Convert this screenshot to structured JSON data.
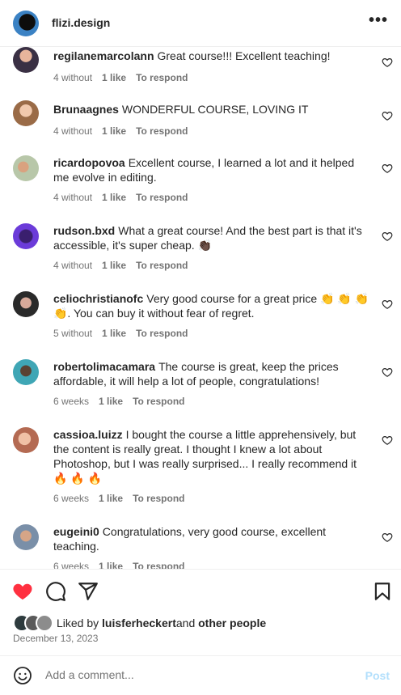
{
  "header": {
    "username": "flizi.design",
    "more_icon": "three-dots-icon"
  },
  "comments": [
    {
      "user": "regilanemarcolann",
      "text": "Great course!!! Excellent teaching!",
      "time": "4 without",
      "likes": "1 like",
      "reply": "To respond"
    },
    {
      "user": "Brunaagnes",
      "text": "WONDERFUL COURSE, LOVING IT",
      "time": "4 without",
      "likes": "1 like",
      "reply": "To respond"
    },
    {
      "user": "ricardopovoa",
      "text": "Excellent course, I learned a lot and it helped me evolve in editing.",
      "time": "4 without",
      "likes": "1 like",
      "reply": "To respond"
    },
    {
      "user": "rudson.bxd",
      "text": "What a great course! And the best part is that it's accessible, it's super cheap. 👏🏿",
      "time": "4 without",
      "likes": "1 like",
      "reply": "To respond"
    },
    {
      "user": "celiochristianofc",
      "text": "Very good course for a great price 👏 👏 👏 👏. You can buy it without fear of regret.",
      "time": "5 without",
      "likes": "1 like",
      "reply": "To respond"
    },
    {
      "user": "robertolimacamara",
      "text": "The course is great, keep the prices affordable, it will help a lot of people, congratulations!",
      "time": "6 weeks",
      "likes": "1 like",
      "reply": "To respond"
    },
    {
      "user": "cassioa.luizz",
      "text": "I bought the course a little apprehensively, but the content is really great. I thought I knew a lot about Photoshop, but I was really surprised... I really recommend it 🔥 🔥 🔥",
      "time": "6 weeks",
      "likes": "1 like",
      "reply": "To respond"
    },
    {
      "user": "eugeini0",
      "text": "Congratulations, very good course, excellent teaching.",
      "time": "6 weeks",
      "likes": "1 like",
      "reply": "To respond"
    }
  ],
  "actions": {
    "like_icon": "heart-filled-icon",
    "comment_icon": "comment-icon",
    "share_icon": "share-icon",
    "save_icon": "bookmark-icon",
    "like_color": "#ff3040"
  },
  "likes": {
    "prefix": "Liked by ",
    "user": "luisferheckert",
    "joiner": "and ",
    "others": "other people"
  },
  "date": "December 13, 2023",
  "add_comment": {
    "placeholder": "Add a comment...",
    "post_label": "Post",
    "emoji_icon": "smiley-icon"
  }
}
